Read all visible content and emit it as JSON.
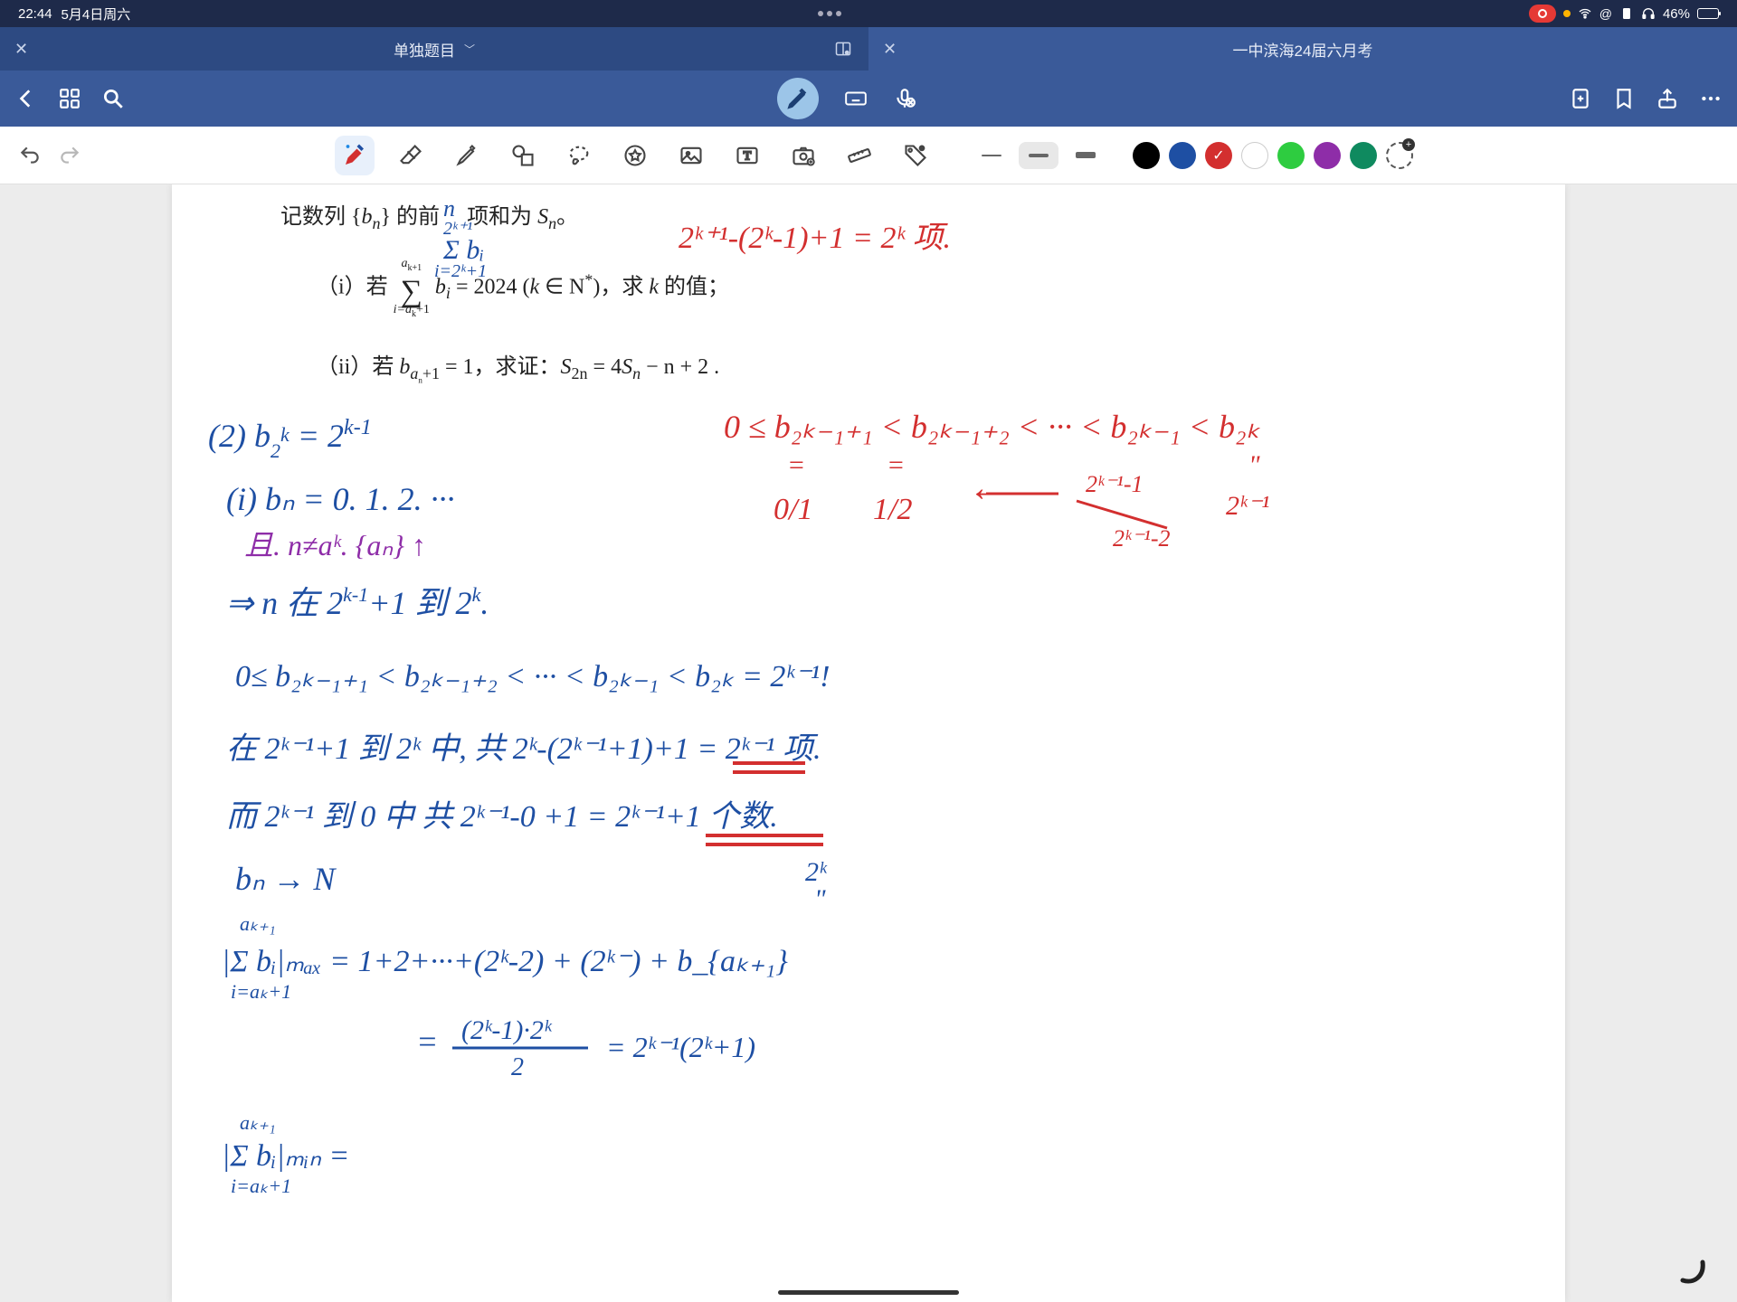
{
  "status": {
    "time": "22:44",
    "date": "5月4日周六",
    "battery_pct": "46%"
  },
  "tabs": {
    "left": {
      "title": "单独题目"
    },
    "right": {
      "title": "一中滨海24届六月考"
    }
  },
  "toolbar": {
    "undo": "undo",
    "redo": "redo"
  },
  "colors": [
    "#000000",
    "#1e4fa3",
    "#d32f2f",
    "#ffffff",
    "#2ecc40",
    "#8e2da8",
    "#0f8a5f"
  ],
  "problem": {
    "line1_pre": "记数列 {",
    "line1_bn": "b",
    "line1_n": "n",
    "line1_post": "} 的前",
    "line1_post2": "项和为 ",
    "line1_S": "S",
    "line1_dot": "。",
    "i_label": "（i）若",
    "i_eq": " = 2024 (",
    "i_k": "k",
    "i_in": " ∈ N",
    "i_star": "*",
    "i_close": ")，求 ",
    "i_k2": "k",
    "i_tail": " 的值；",
    "sigma_top": "a",
    "sigma_top_k1": "k+1",
    "sigma_bot_pre": "i=a",
    "sigma_bot_k": "k",
    "sigma_bot_p1": "+1",
    "sigma_body": "b",
    "sigma_body_i": "i",
    "ii_label": "（ii）若 ",
    "ii_b": "b",
    "ii_sub_pre": "a",
    "ii_sub_n": "n",
    "ii_sub_p1": "+1",
    "ii_eq1": " = 1，求证：",
    "ii_S": "S",
    "ii_2n": "2n",
    "ii_eq2": " = 4",
    "ii_S2": "S",
    "ii_n2": "n",
    "ii_tail": " − n + 2 ."
  },
  "hw": {
    "blue1a": "(2) b",
    "blue1b": "2",
    "blue1c": "k",
    "blue1d": " = 2",
    "blue1e": "k-1",
    "blue2": "(i)  bₙ = 0. 1. 2. ···",
    "purple1": "且. n≠aᵏ.    {aₙ} ↑",
    "blue3a": "⇒   n 在 2",
    "blue3b": "k-1",
    "blue3c": "+1 到 2",
    "blue3d": "k",
    "blue3e": ".",
    "blue4": "0≤ b₂ₖ₋₁₊₁ < b₂ₖ₋₁₊₂ < ··· < b₂ₖ₋₁ < b₂ₖ = 2ᵏ⁻¹!",
    "blue5": "在 2ᵏ⁻¹+1 到 2ᵏ 中, 共 2ᵏ-(2ᵏ⁻¹+1)+1 = 2ᵏ⁻¹ 项.",
    "blue6": "而 2ᵏ⁻¹ 到 0 中 共 2ᵏ⁻¹-0 +1 = 2ᵏ⁻¹+1 个数.",
    "blue7": "bₙ → N",
    "blue7b": "2ᵏ",
    "blue7c": "\"",
    "blue8": "|Σ bᵢ|ₘₐₓ = 1+2+···+(2ᵏ-2) + (2ᵏ⁻) + b_{aₖ₊₁}",
    "blue8top": "aₖ₊₁",
    "blue8bot": "i=aₖ+1",
    "blue9a": "= ",
    "blue9b": "(2ᵏ-1)·2ᵏ",
    "blue9c": "2",
    "blue9d": " = 2ᵏ⁻¹(2ᵏ+1)",
    "blue10": "|Σ bᵢ|ₘᵢₙ =",
    "blue10top": "aₖ₊₁",
    "blue10bot": "i=aₖ+1",
    "red_top": "2ᵏ⁺¹-(2ᵏ-1)+1 = 2ᵏ 项.",
    "red_ineq": "0 ≤ b₂ₖ₋₁₊₁ < b₂ₖ₋₁₊₂ < ···   < b₂ₖ₋₁ < b₂ₖ",
    "red_below_0": "=",
    "red_below_0b": "0/1",
    "red_below_1": "=",
    "red_below_1b": "1/2",
    "red_arrow": "←",
    "red_frac_a": "2ᵏ⁻¹-1",
    "red_frac_b": "2ᵏ⁻¹-2",
    "red_last_a": "\"",
    "red_last_b": "2ᵏ⁻¹",
    "sigma_note_top": "2ᵏ⁺¹",
    "sigma_note_mid": "Σ bᵢ",
    "sigma_note_bot": "i=2ᵏ+1"
  }
}
